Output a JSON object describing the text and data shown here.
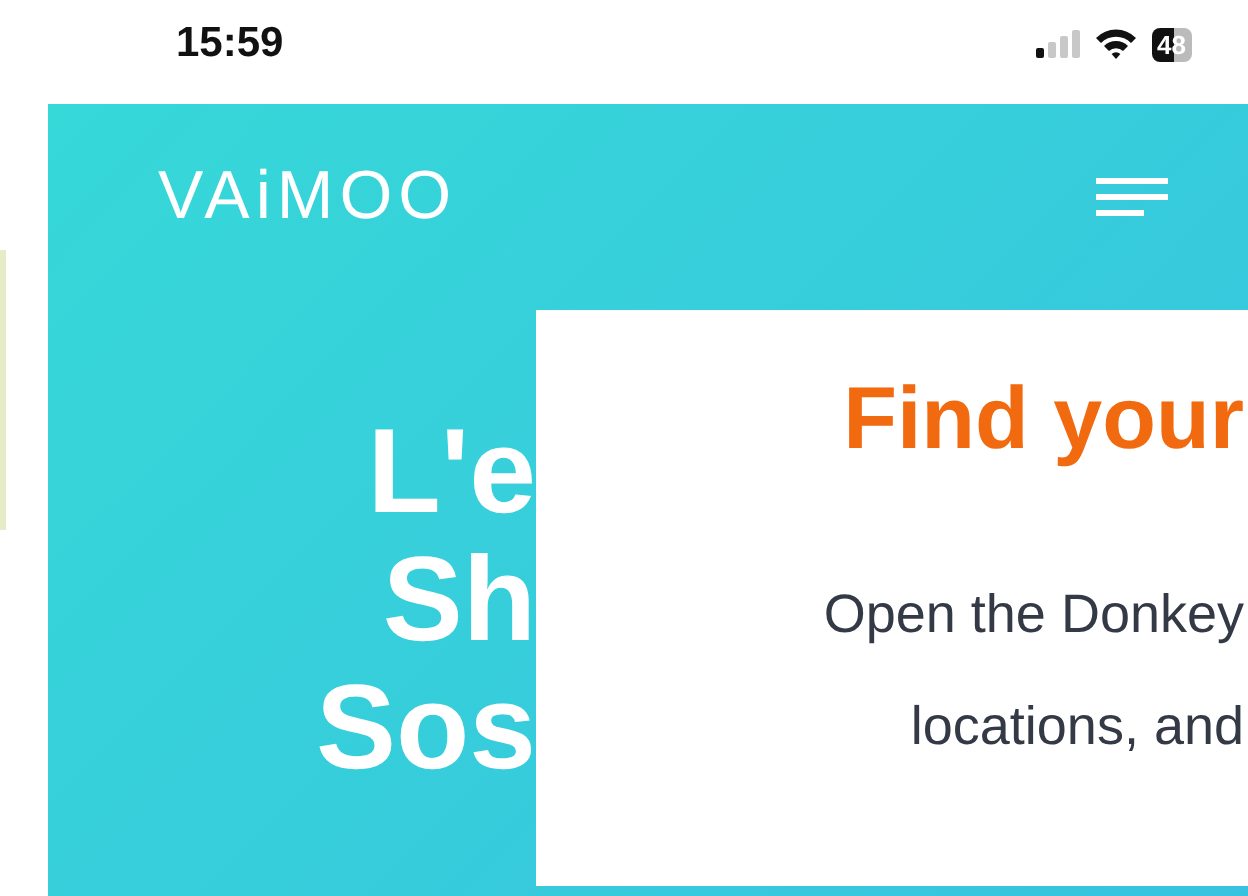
{
  "status_bar": {
    "time": "15:59",
    "battery": "48"
  },
  "header": {
    "logo": "VAiMOO"
  },
  "hero": {
    "lines": [
      "L'e",
      "Sh",
      "Sos"
    ]
  },
  "popup": {
    "title": "Find your",
    "body_lines": [
      "Open the Donkey",
      "locations, and"
    ]
  }
}
